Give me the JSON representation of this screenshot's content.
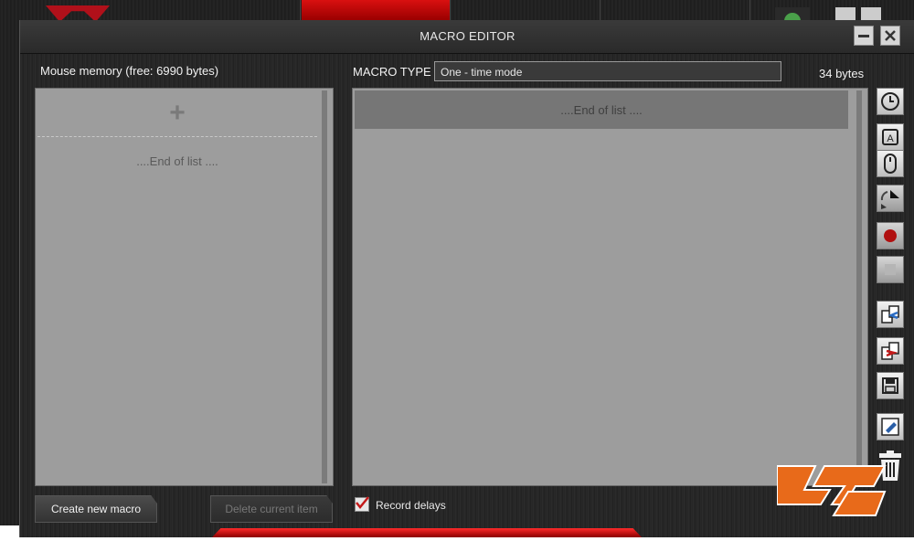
{
  "dialog": {
    "title": "MACRO EDITOR",
    "minimize_icon": "minimize-icon",
    "close_icon": "close-icon"
  },
  "left_panel": {
    "memory_label": "Mouse memory (free: 6990 bytes)",
    "add_icon": "plus-icon",
    "end_of_list": "....End of list ...."
  },
  "macro_type": {
    "label": "MACRO TYPE",
    "selected": "One - time mode"
  },
  "bytes_label": "34 bytes",
  "right_panel": {
    "end_of_list": "....End of list ...."
  },
  "toolbar": [
    {
      "name": "delay-clock-icon"
    },
    {
      "name": "keyboard-key-icon"
    },
    {
      "name": "mouse-button-icon"
    },
    {
      "name": "cursor-action-icon"
    },
    {
      "name": "record-icon"
    },
    {
      "name": "stop-icon"
    },
    {
      "name": "import-icon"
    },
    {
      "name": "export-icon"
    },
    {
      "name": "save-icon"
    },
    {
      "name": "edit-icon"
    },
    {
      "name": "trash-icon"
    }
  ],
  "footer": {
    "create_button": "Create new macro",
    "delete_button": "Delete current item",
    "record_delays_label": "Record delays",
    "record_delays_checked": true
  },
  "colors": {
    "accent_red": "#c41a1a",
    "panel_gray": "#9d9d9d"
  }
}
